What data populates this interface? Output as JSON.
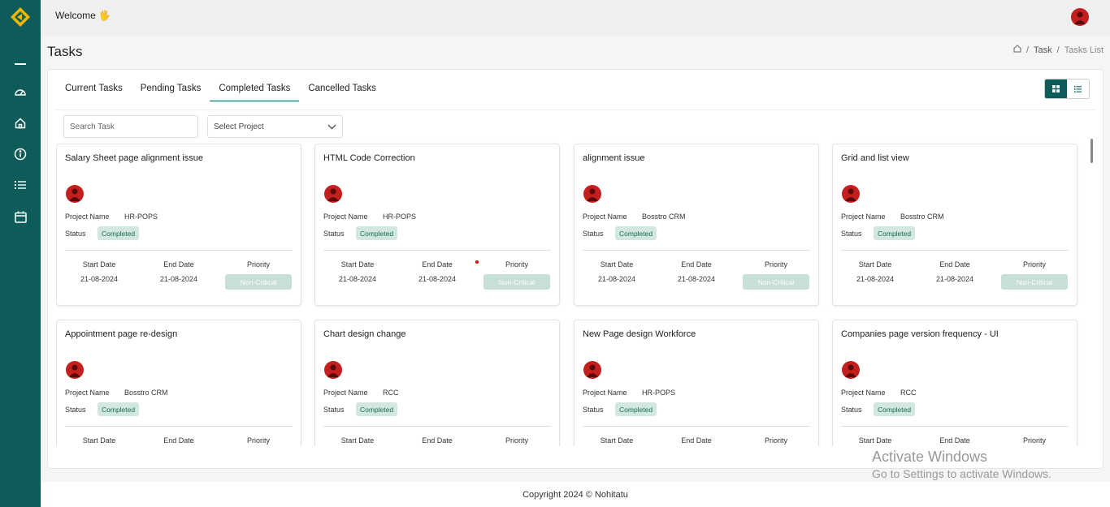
{
  "header": {
    "welcome": "Welcome 🖐"
  },
  "page": {
    "title": "Tasks",
    "breadcrumb": [
      "Task",
      "Tasks List"
    ]
  },
  "tabs": [
    "Current Tasks",
    "Pending Tasks",
    "Completed Tasks",
    "Cancelled Tasks"
  ],
  "active_tab": "Completed Tasks",
  "filters": {
    "search_placeholder": "Search Task",
    "project_placeholder": "Select Project"
  },
  "card_labels": {
    "project_name": "Project Name",
    "status": "Status",
    "start_date": "Start Date",
    "end_date": "End Date",
    "priority": "Priority"
  },
  "tasks": [
    {
      "title": "Salary Sheet page alignment issue",
      "project": "HR-POPS",
      "status": "Completed",
      "start": "21-08-2024",
      "end": "21-08-2024",
      "priority": "Non-Critical"
    },
    {
      "title": "HTML Code Correction",
      "project": "HR-POPS",
      "status": "Completed",
      "start": "21-08-2024",
      "end": "21-08-2024",
      "priority": "Non-Critical"
    },
    {
      "title": "alignment issue",
      "project": "Bosstro CRM",
      "status": "Completed",
      "start": "21-08-2024",
      "end": "21-08-2024",
      "priority": "Non-Critical"
    },
    {
      "title": "Grid and list view",
      "project": "Bosstro CRM",
      "status": "Completed",
      "start": "21-08-2024",
      "end": "21-08-2024",
      "priority": "Non-Critical"
    },
    {
      "title": "Appointment page re-design",
      "project": "Bosstro CRM",
      "status": "Completed"
    },
    {
      "title": "Chart design change",
      "project": "RCC",
      "status": "Completed"
    },
    {
      "title": "New Page design Workforce",
      "project": "HR-POPS",
      "status": "Completed"
    },
    {
      "title": "Companies page version frequency - UI",
      "project": "RCC",
      "status": "Completed"
    }
  ],
  "watermark": {
    "line1": "Activate Windows",
    "line2": "Go to Settings to activate Windows."
  },
  "footer": {
    "copyright": "Copyright 2024 © Nohitatu"
  },
  "colors": {
    "sidebar": "#0d5c5a",
    "accent": "#0d5c5a",
    "badge_bg": "#d3e7e1",
    "priority_bg": "#c7dfd4",
    "avatar": "#c41f1f"
  }
}
